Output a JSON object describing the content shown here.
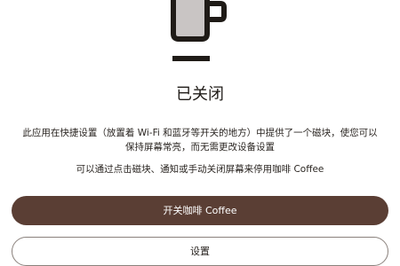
{
  "status": {
    "title": "已关闭",
    "icon": "coffee-cup-icon"
  },
  "description": "此应用在快捷设置（放置着 Wi-Fi 和蓝牙等开关的地方）中提供了一个磁块，使您可以保持屏幕常亮，而无需更改设备设置",
  "hint": "可以通过点击磁块、通知或手动关闭屏幕来停用咖啡 Coffee",
  "buttons": {
    "toggle_label": "开关咖啡 Coffee",
    "settings_label": "设置"
  },
  "colors": {
    "primary": "#5a3e34",
    "cup_fill": "#c9c5c4",
    "cup_stroke": "#1f1b17"
  }
}
